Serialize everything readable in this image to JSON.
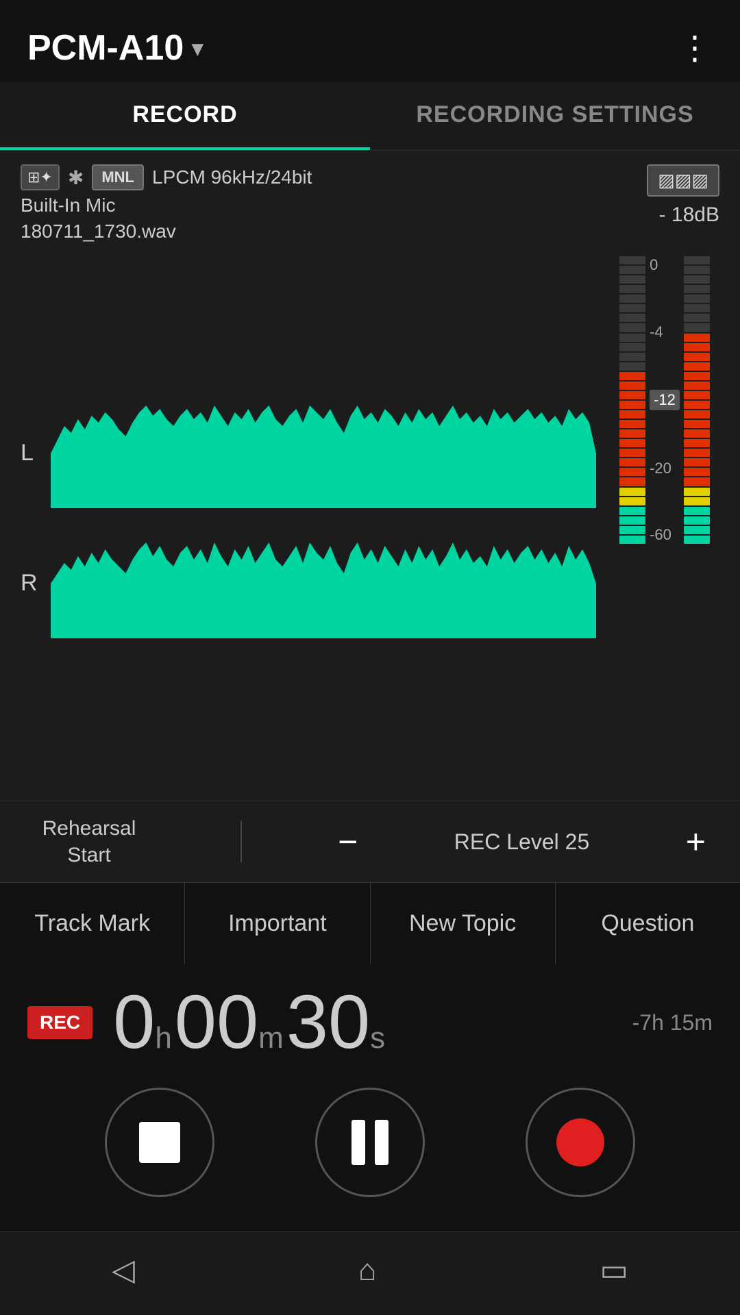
{
  "header": {
    "title": "PCM-A10",
    "dropdown_label": "▾",
    "menu_icon": "⋮"
  },
  "tabs": [
    {
      "label": "RECORD",
      "active": true
    },
    {
      "label": "RECORDING SETTINGS",
      "active": false
    }
  ],
  "status": {
    "icons": [
      "⊞✦",
      "✱",
      "MNL"
    ],
    "format": "LPCM 96kHz/24bit",
    "mic": "Built-In Mic",
    "filename": "180711_1730.wav",
    "db_label": "- 18dB",
    "battery": "▨▨▨"
  },
  "vu_meter": {
    "labels": [
      "0",
      "-4",
      "-12",
      "-20",
      "-60"
    ],
    "marker": "-12"
  },
  "level_control": {
    "rehearsal_label": "Rehearsal\nStart",
    "minus_label": "−",
    "level_text": "REC Level 25",
    "plus_label": "+"
  },
  "mark_buttons": [
    {
      "label": "Track Mark"
    },
    {
      "label": "Important"
    },
    {
      "label": "New Topic"
    },
    {
      "label": "Question"
    }
  ],
  "timer": {
    "rec_badge": "REC",
    "hours": "0",
    "hours_unit": "h",
    "minutes": "00",
    "minutes_unit": "m",
    "seconds": "30",
    "seconds_unit": "s",
    "remaining": "-7h 15m"
  },
  "transport": {
    "stop_label": "stop",
    "pause_label": "pause",
    "record_label": "record"
  },
  "nav": {
    "back_icon": "◁",
    "home_icon": "⌂",
    "recent_icon": "▭"
  }
}
